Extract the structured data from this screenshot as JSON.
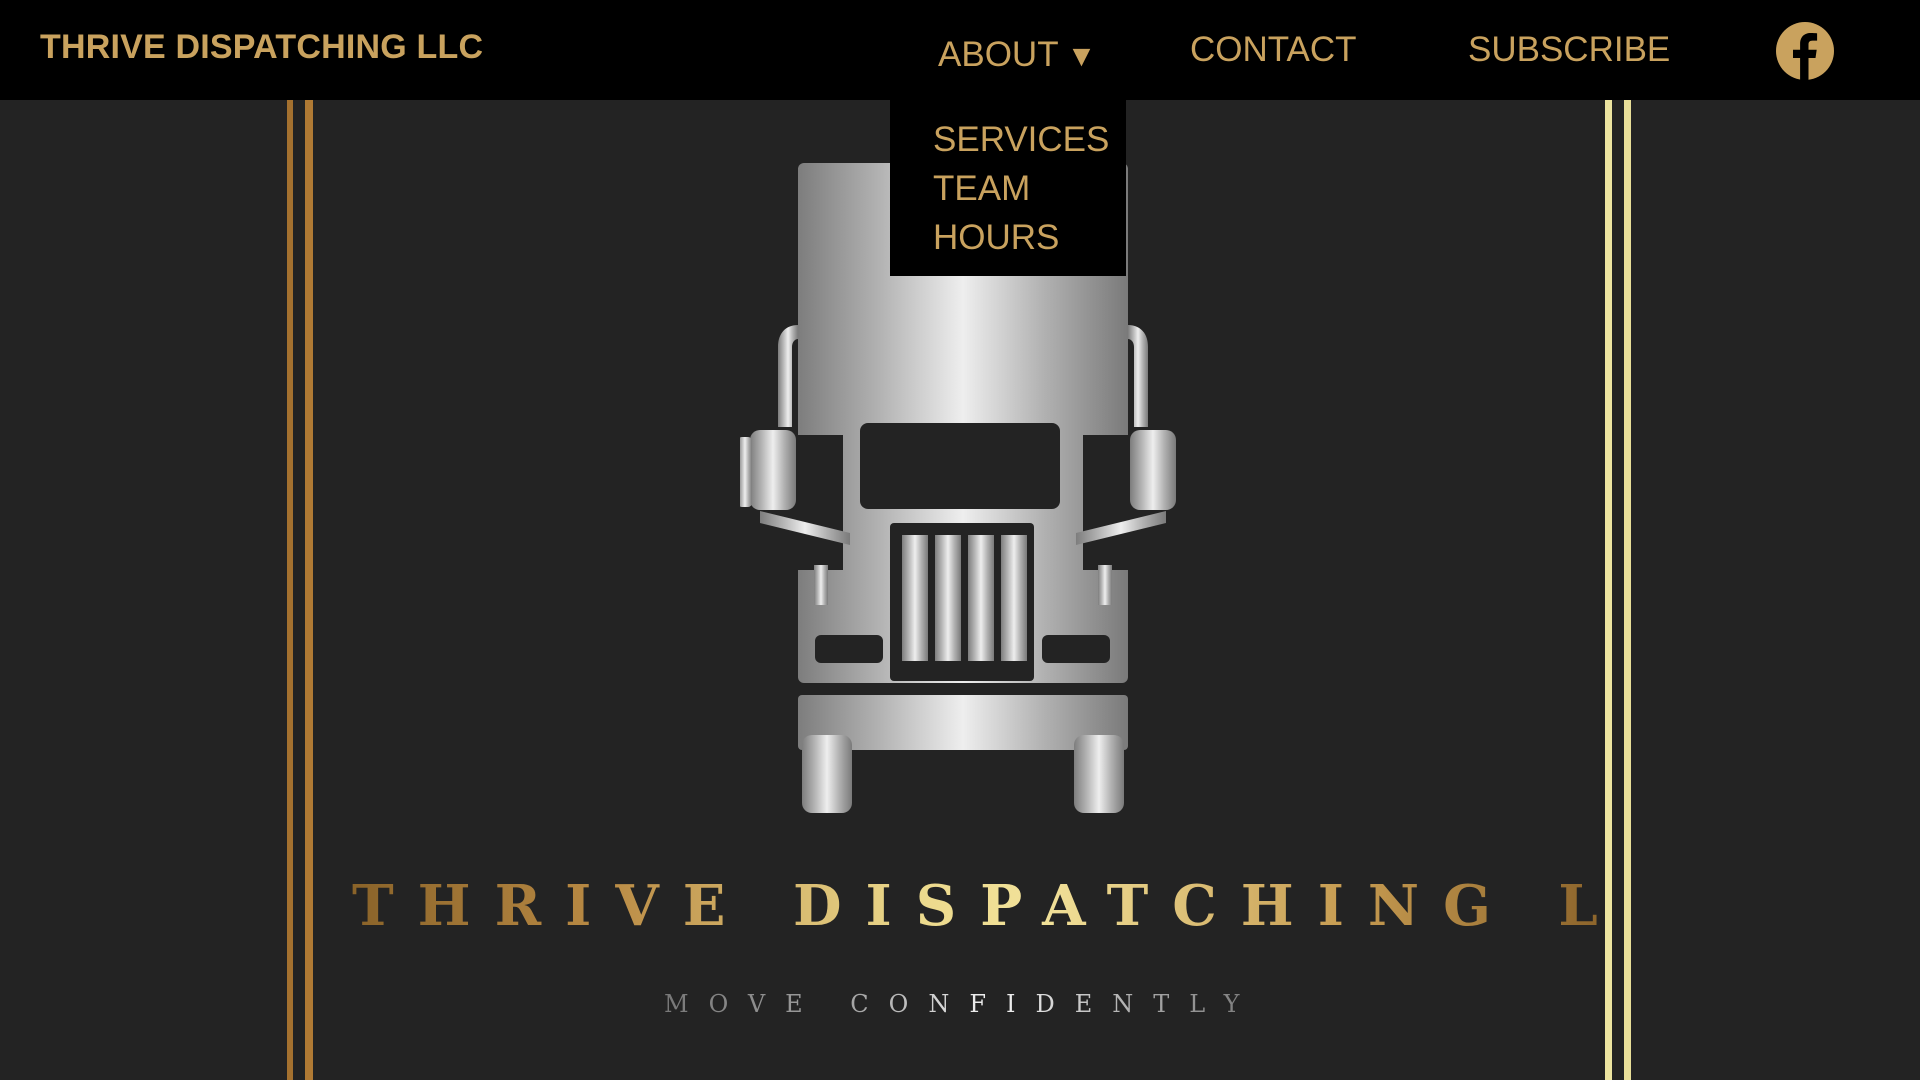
{
  "nav": {
    "brand": "THRIVE DISPATCHING LLC",
    "about": "ABOUT",
    "about_caret": "▼",
    "contact": "CONTACT",
    "subscribe": "SUBSCRIBE",
    "social_icon": "facebook-icon"
  },
  "dropdown": {
    "items": [
      "SERVICES",
      "TEAM",
      "HOURS"
    ]
  },
  "hero": {
    "logo_icon": "semi-truck-icon",
    "title": "THRIVE DISPATCHING LLC",
    "tagline": "MOVE CONFIDENTLY"
  },
  "colors": {
    "accent_gold": "#c9a25e",
    "nav_background": "#000000",
    "page_background": "#232323"
  }
}
